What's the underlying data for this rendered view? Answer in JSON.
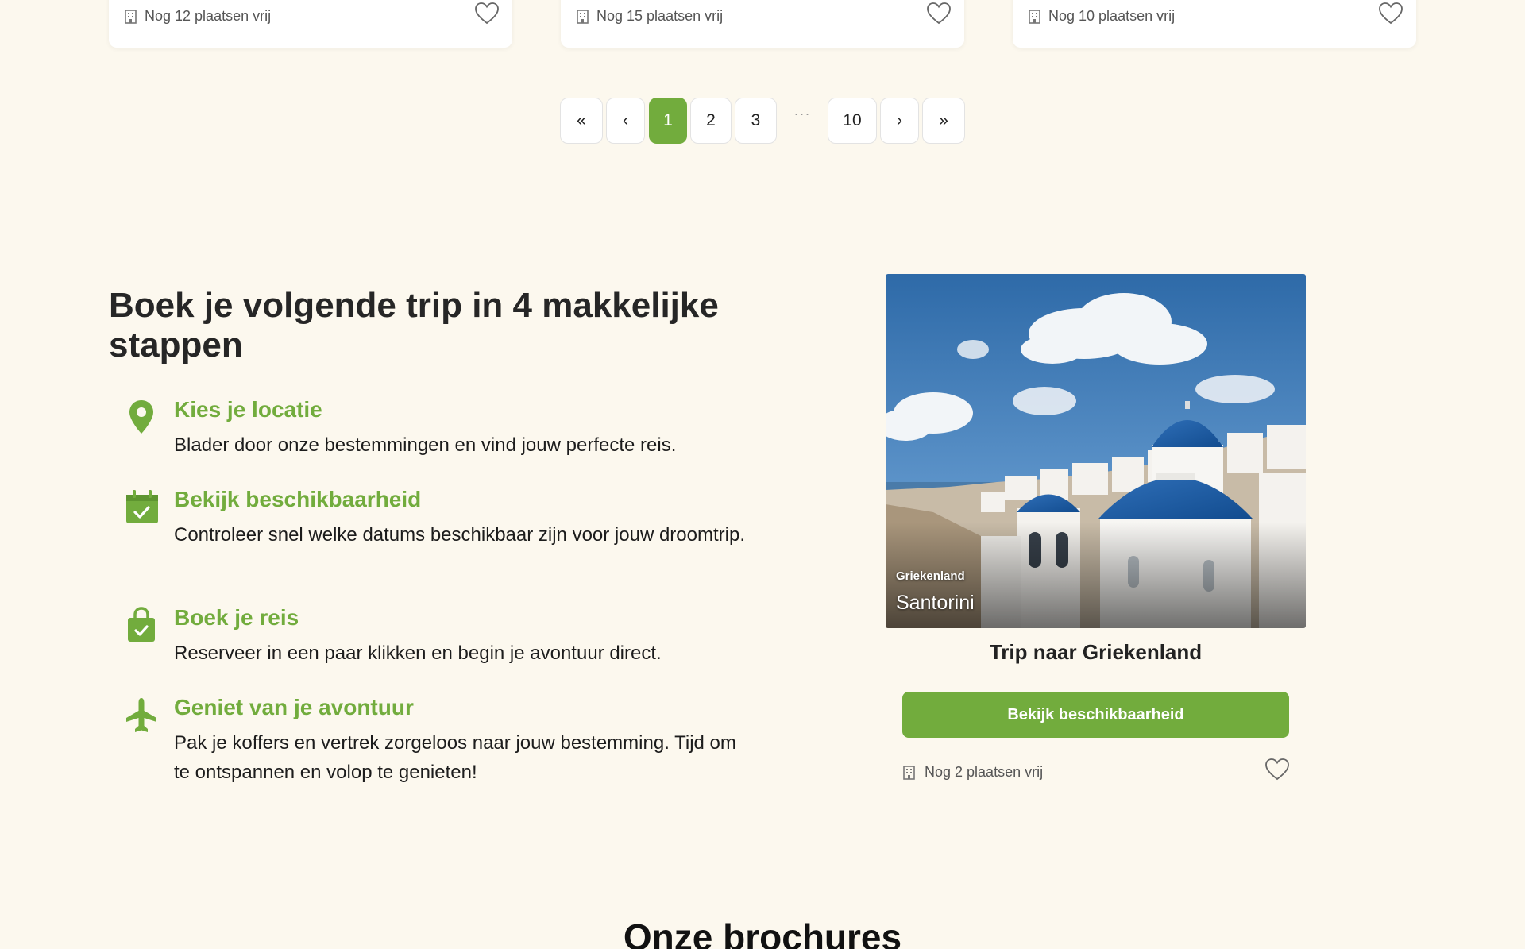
{
  "top_cards": [
    {
      "availability": "Nog 12 plaatsen vrij"
    },
    {
      "availability": "Nog 15 plaatsen vrij"
    },
    {
      "availability": "Nog 10 plaatsen vrij"
    }
  ],
  "pagination": {
    "first": "«",
    "prev": "‹",
    "pages": [
      "1",
      "2",
      "3"
    ],
    "active_page": "1",
    "ellipsis": "···",
    "last_page": "10",
    "next": "›",
    "last": "»"
  },
  "steps_section": {
    "title": "Boek je volgende trip in 4 makkelijke stappen",
    "steps": [
      {
        "icon": "map-pin-icon",
        "title": "Kies je locatie",
        "description": "Blader door onze bestemmingen en vind jouw perfecte reis."
      },
      {
        "icon": "calendar-check-icon",
        "title": "Bekijk beschikbaarheid",
        "description": "Controleer snel welke datums beschikbaar zijn voor jouw droomtrip."
      },
      {
        "icon": "shopping-bag-check-icon",
        "title": "Boek je reis",
        "description": "Reserveer in een paar klikken en begin je avontuur direct."
      },
      {
        "icon": "airplane-icon",
        "title": "Geniet van je avontuur",
        "description": "Pak je koffers en vertrek zorgeloos naar jouw bestemming. Tijd om te ontspannen en volop te genieten!"
      }
    ]
  },
  "trip_card": {
    "image_country": "Griekenland",
    "image_place": "Santorini",
    "title": "Trip naar Griekenland",
    "cta_label": "Bekijk beschikbaarheid",
    "availability": "Nog 2 plaatsen vrij"
  },
  "brochures": {
    "title": "Onze brochures"
  },
  "colors": {
    "accent_green": "#72ac3d",
    "background": "#fcf8ee",
    "text_dark": "#262626"
  }
}
